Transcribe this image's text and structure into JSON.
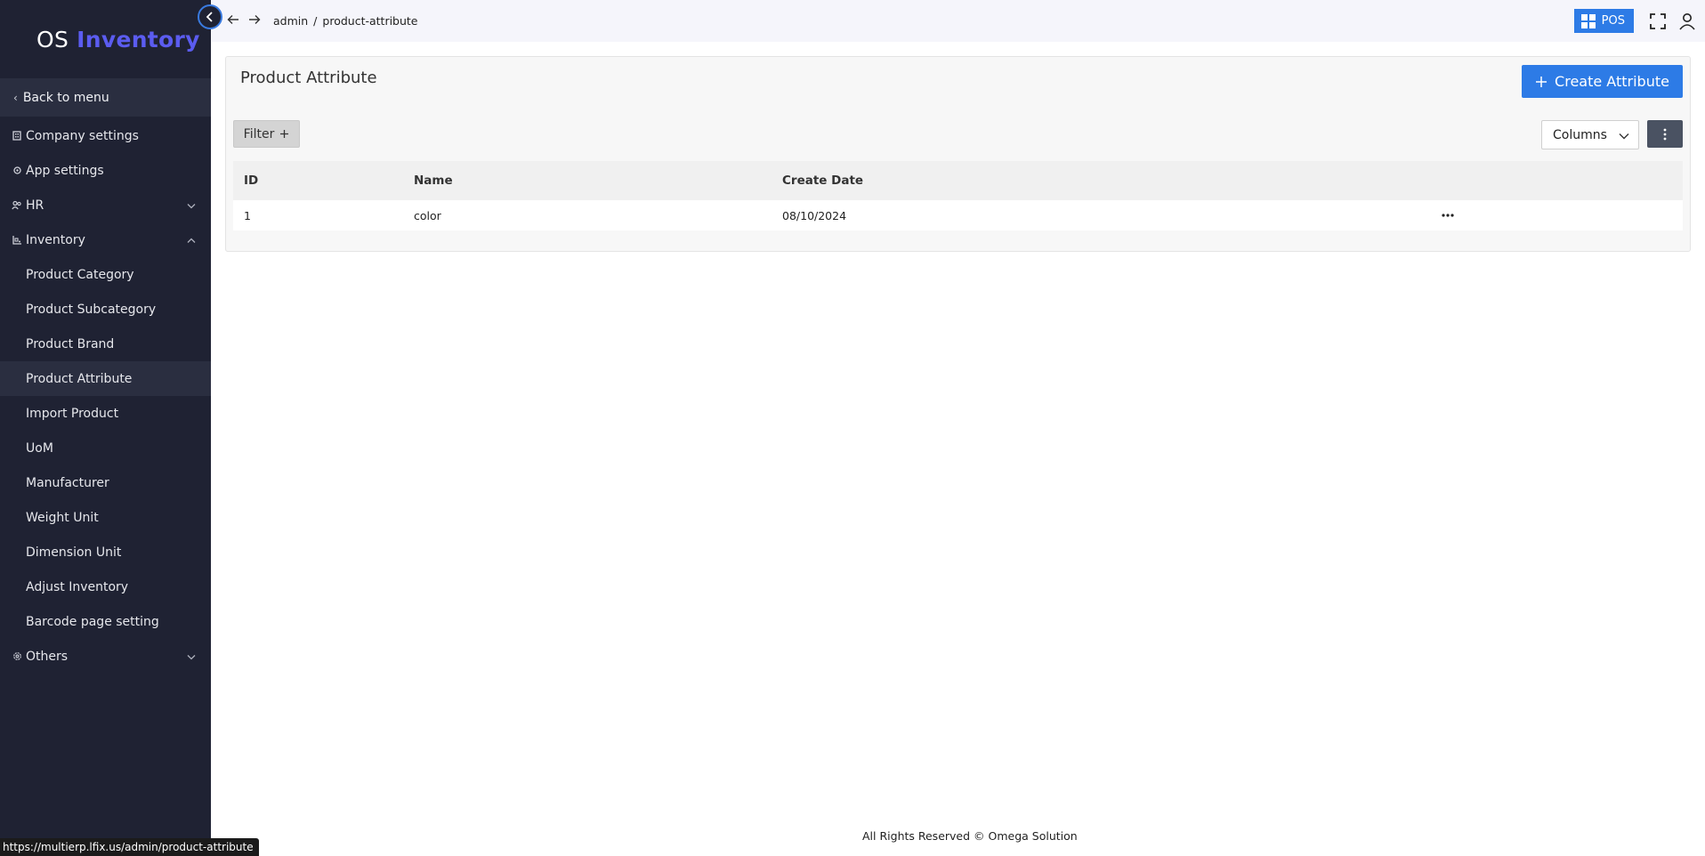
{
  "app": {
    "logo_prefix": "OS",
    "logo_brand": "Inventory"
  },
  "sidebar": {
    "back_label": "Back to menu",
    "items": [
      {
        "label": "Company settings",
        "icon": "building-icon"
      },
      {
        "label": "App settings",
        "icon": "gear-icon"
      },
      {
        "label": "HR",
        "icon": "people-icon"
      },
      {
        "label": "Inventory",
        "icon": "inventory-icon"
      }
    ],
    "inventory_sub": [
      "Product Category",
      "Product Subcategory",
      "Product Brand",
      "Product Attribute",
      "Import Product",
      "UoM",
      "Manufacturer",
      "Weight Unit",
      "Dimension Unit",
      "Adjust Inventory",
      "Barcode page setting"
    ],
    "others_label": "Others",
    "active": "Product Attribute"
  },
  "topbar": {
    "breadcrumb": [
      "admin",
      "/",
      "product-attribute"
    ],
    "pos_label": "POS"
  },
  "page": {
    "title": "Product Attribute",
    "create_label": "Create Attribute",
    "filter_label": "Filter",
    "columns_label": "Columns"
  },
  "table": {
    "headers": [
      "ID",
      "Name",
      "Create Date"
    ],
    "rows": [
      {
        "id": "1",
        "name": "color",
        "date": "08/10/2024"
      }
    ]
  },
  "footer": {
    "text": "All Rights Reserved © Omega Solution"
  },
  "status_url": "https://multierp.lfix.us/admin/product-attribute",
  "colors": {
    "sidebar_bg": "#1f2233",
    "accent": "#2d7be6",
    "brand": "#5b5cf0"
  }
}
